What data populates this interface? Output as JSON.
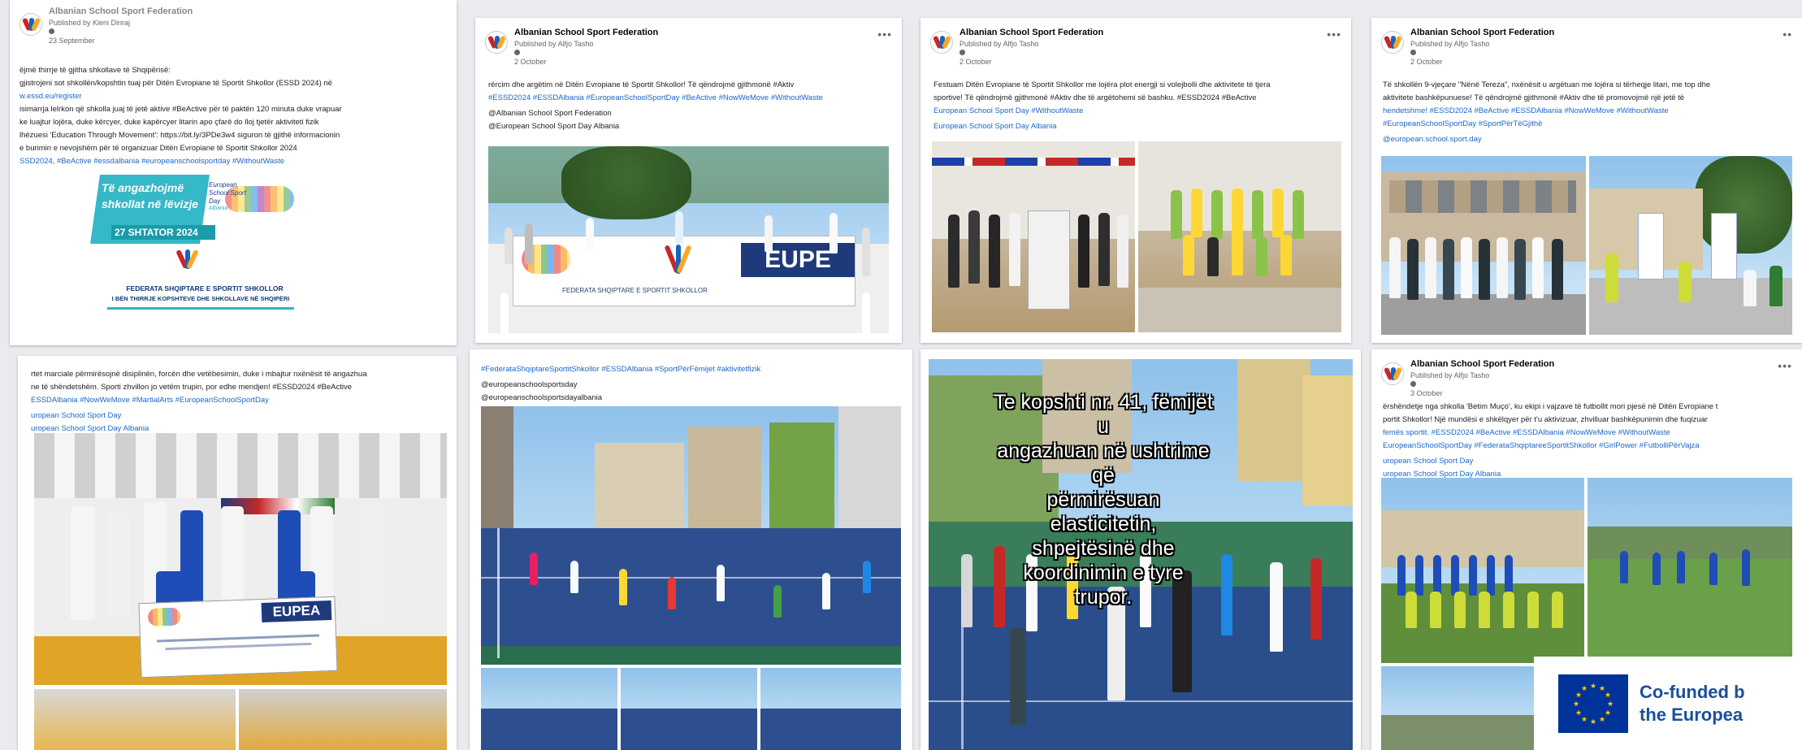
{
  "posts": [
    {
      "page": "Albanian School Sport Federation",
      "byline": "Published by Kleni Dinraj",
      "date": "23 September",
      "lines": [
        "ëjmë thirrje të gjitha shkollave të Shqipërisë:",
        "gjistrojeni sot shkollën/kopshtin tuaj për Ditën Evropiane të Sportit Shkollor (ESSD 2024) në",
        "w.essd.eu/register",
        "isimarrja lelrkon që shkolla juaj të jetë aktive #BeActive për të paktën 120 minuta duke vrapuar",
        "ke luajtur lojëra, duke kërcyer, duke kapërcyer litarin apo çfarë do lloj tjetër aktiviteti fizik",
        "lhëzuesi 'Education Through Movement': https://bit.ly/3PDe3w4 siguron të gjithë informacionin",
        "e burimin e nevojshëm për të organizuar Ditën Evropiane të Sportit Shkollor 2024",
        "SSD2024, #BeActive #essdalbania #europeanschoolsportday #WithoutWaste"
      ],
      "banner": {
        "line1": "Të angazhojmë",
        "line2": "shkollat në lëvizje",
        "date": "27 SHTATOR 2024",
        "essd1": "European",
        "essd2": "School Sport",
        "essd3": "Day",
        "essd4": "Albania",
        "fed1": "FEDERATA SHQIPTARE E SPORTIT SHKOLLOR",
        "fed2": "I BËN THIRRJE KOPSHTEVE DHE SHKOLLAVE NË SHQIPËRI"
      }
    },
    {
      "page": "Albanian School Sport Federation",
      "byline": "Published by Alfjo Tasho",
      "date": "2 October",
      "lines": [
        "rërcim dhe argëtim në Ditën Evropiane të Sportit Shkollor! Të qëndrojmë gjithmonë #Aktiv",
        "#ESSD2024 #ESSDAlbania #EuropeanSchoolSportDay #BeActive #NowWeMove #WithoutWaste",
        "@Albanian School Sport Federation",
        "@European School Sport Day Albania"
      ],
      "banner_text": "EUPE",
      "banner_sub": "FEDERATA SHQIPTARE E SPORTIT SHKOLLOR"
    },
    {
      "page": "Albanian School Sport Federation",
      "byline": "Published by Alfjo Tasho",
      "date": "2 October",
      "lines": [
        "Festuam Ditën Evropiane të Sportit Shkollor me lojëra plot energji si volejbolli dhe aktivitete të tjera",
        "sportive! Të qëndrojmë gjithmonë #Aktiv dhe të argëtohemi së bashku. #ESSD2024 #BeActive",
        "European School Sport Day #WithoutWaste",
        "European School Sport Day Albania"
      ]
    },
    {
      "page": "Albanian School Sport Federation",
      "byline": "Published by Alfjo Tasho",
      "date": "2 October",
      "lines": [
        "Të shkollën 9-vjeçare \"Nënë Tereza\", nxënësit u argëtuan me lojëra si tërheqje litari, me top dhe",
        "aktivitete bashkëpunuese! Të qëndrojmë gjithmonë #Aktiv dhe të promovojmë një jetë të",
        "hendetshme! #ESSD2024 #BeActive #ESSDAlbania #NowWeMove #WithoutWaste",
        "#EuropeanSchoolSportDay #SportPërTëGjithë",
        "@european.school.sport.day"
      ]
    },
    {
      "lines": [
        "rtet marciale përmirësojnë disiplinën, forcën dhe vetëbesimin, duke i mbajtur nxënësit të angazhua",
        "ne të shëndetshëm. Sporti zhvillon jo vetëm trupin, por edhe mendjen! #ESSD2024 #BeActive",
        "ESSDAlbania #NowWeMove #MartialArts #EuropeanSchoolSportDay",
        "uropean School Sport Day",
        "uropean School Sport Day Albania"
      ],
      "banner_text": "EUPEA"
    },
    {
      "lines": [
        "#FederataShqiptareSportitShkollor #ESSDAlbania #SportPërFëmijet #aktivitetfizik",
        "@europeanschoolsportsday",
        "@europeanschoolsportsdayalbania"
      ]
    },
    {
      "overlay": "Te kopshti nr. 41, fëmijët u\nangazhuan në ushtrime që\npërmirësuan elasticitetin,\nshpejtësinë dhe koordinimin e tyre\ntrupor."
    },
    {
      "page": "Albanian School Sport Federation",
      "byline": "Published by Alfjo Tasho",
      "date": "3 October",
      "lines": [
        "ërshëndetje nga shkolla 'Betim Muço', ku ekipi i vajzave të futbollit mori pjesë në Ditën Evropiane t",
        "portit Shkollor! Një mundësi e shkëlqyer për t'u aktivizuar, zhvilluar bashkëpunimin dhe fuqizuar",
        "femës sportit. #ESSD2024 #BeActive #ESSDAlbania #NowWeMove #WithoutWaste",
        "EuropeanSchoolSportDay #FederataShqiptareeSportitShkollor #GirlPower #FutbolliPërVajza",
        "uropean School Sport Day",
        "uropean School Sport Day Albania"
      ]
    }
  ],
  "eu_badge": {
    "line1": "Co-funded b",
    "line2": "the Europea"
  },
  "colors": {
    "link": "#1a67c8",
    "eu_blue": "#003399",
    "brand_cyan": "#29b6c9"
  }
}
